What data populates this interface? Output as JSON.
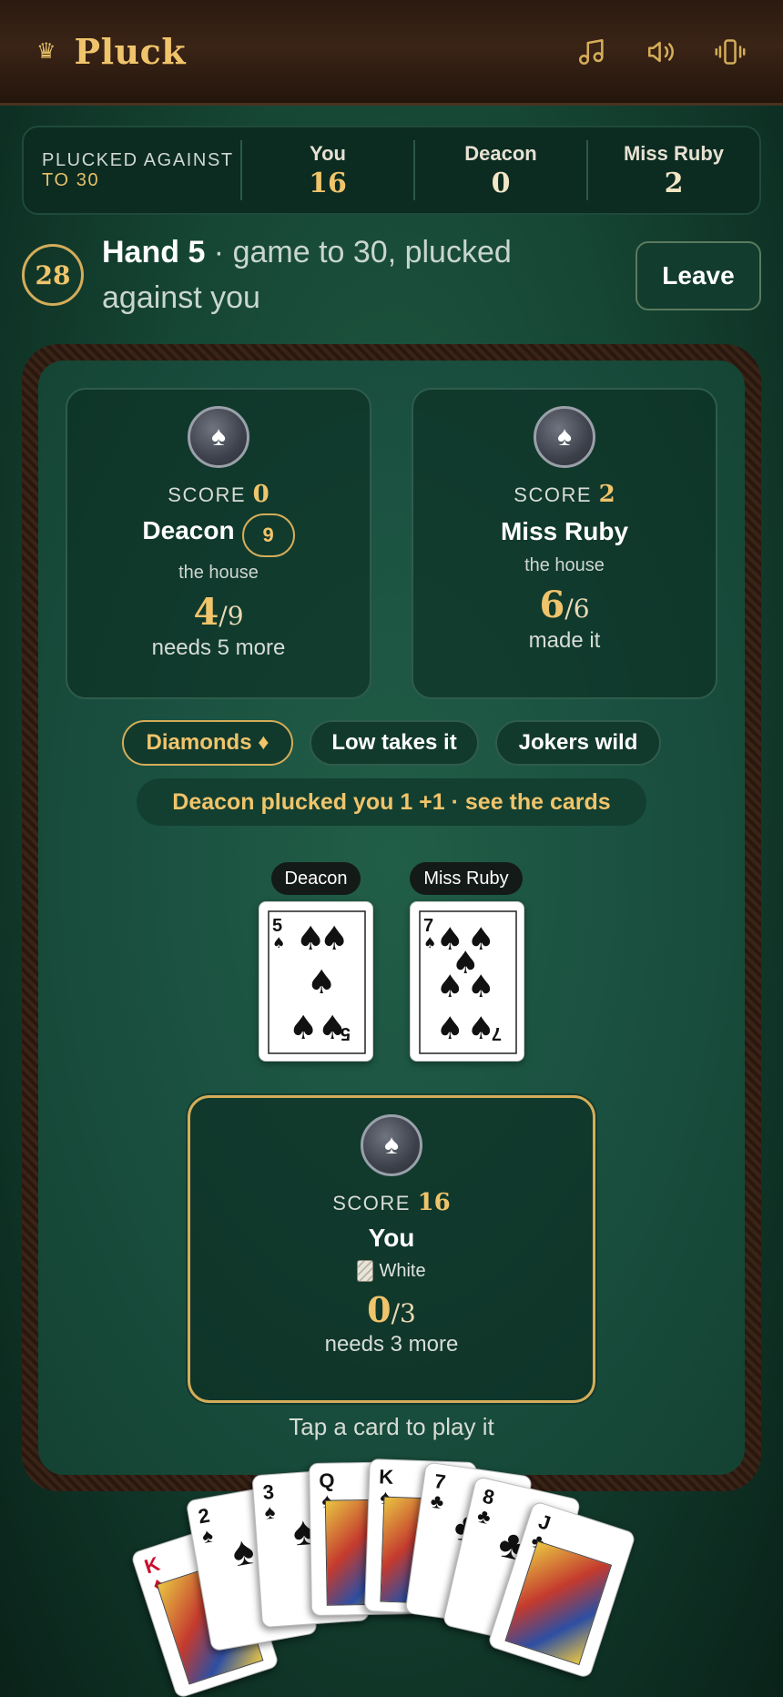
{
  "header": {
    "brand": "Pluck",
    "crown_icon": "crown-icon",
    "icons": [
      "music-icon",
      "speaker-icon",
      "vibrate-icon"
    ]
  },
  "scoreboard": {
    "label_line1": "PLUCKED AGAINST",
    "label_line2": "TO 30",
    "players": [
      {
        "name": "You",
        "score": "16"
      },
      {
        "name": "Deacon",
        "score": "0"
      },
      {
        "name": "Miss Ruby",
        "score": "2"
      }
    ]
  },
  "hand": {
    "pot": "28",
    "title": "Hand 5",
    "subtitle": " · game to 30, plucked against you",
    "leave_label": "Leave"
  },
  "opponents": [
    {
      "score_label": "SCORE",
      "score": "0",
      "name": "Deacon",
      "bid": "9",
      "role": "the house",
      "got": "4",
      "need": "/9",
      "status": "needs 5 more"
    },
    {
      "score_label": "SCORE",
      "score": "2",
      "name": "Miss Ruby",
      "role": "the house",
      "got": "6",
      "need": "/6",
      "status": "made it"
    }
  ],
  "rules": {
    "trump": "Diamonds ♦",
    "low": "Low takes it",
    "jokers": "Jokers wild"
  },
  "notice": "Deacon plucked you 1 +1 · see the cards",
  "trick": [
    {
      "player": "Deacon",
      "rank": "5",
      "suit": "♠"
    },
    {
      "player": "Miss Ruby",
      "rank": "7",
      "suit": "♠"
    }
  ],
  "you": {
    "score_label": "SCORE",
    "score": "16",
    "name": "You",
    "color_label": "White",
    "got": "0",
    "need": "/3",
    "status": "needs 3 more"
  },
  "hint": "Tap a card to play it",
  "player_hand": [
    {
      "rank": "K",
      "suit": "♦",
      "color": "#c8102e"
    },
    {
      "rank": "2",
      "suit": "♠",
      "color": "#111111"
    },
    {
      "rank": "3",
      "suit": "♠",
      "color": "#111111"
    },
    {
      "rank": "Q",
      "suit": "♠",
      "color": "#111111"
    },
    {
      "rank": "K",
      "suit": "♠",
      "color": "#111111"
    },
    {
      "rank": "7",
      "suit": "♣",
      "color": "#111111"
    },
    {
      "rank": "8",
      "suit": "♣",
      "color": "#111111"
    },
    {
      "rank": "J",
      "suit": "♣",
      "color": "#111111"
    }
  ],
  "colors": {
    "gold": "#f0c46b",
    "felt": "#1a5040",
    "wood": "#3a2418"
  }
}
